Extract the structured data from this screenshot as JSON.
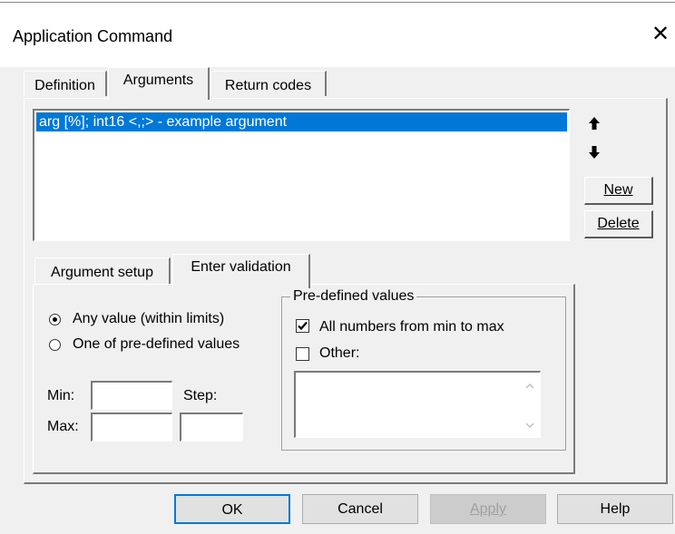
{
  "window": {
    "title": "Application Command",
    "close_glyph": "✕"
  },
  "tabs": [
    {
      "label": "Definition"
    },
    {
      "label": "Arguments"
    },
    {
      "label": "Return codes"
    }
  ],
  "arguments_list": {
    "items": [
      "arg [%]; int16 <,;> - example argument"
    ],
    "selected_index": 0
  },
  "side_buttons": {
    "up_icon": "▲",
    "down_icon": "▼",
    "new_label": "New",
    "delete_label": "Delete"
  },
  "subtabs": [
    {
      "label": "Argument setup"
    },
    {
      "label": "Enter validation"
    }
  ],
  "validation": {
    "any_value_label": "Any value (within limits)",
    "any_value_selected": true,
    "one_of_label": "One of pre-defined values",
    "one_of_selected": false,
    "min_label": "Min:",
    "max_label": "Max:",
    "step_label": "Step:",
    "min_value": "",
    "max_value": "",
    "step_value": "",
    "step2_value": ""
  },
  "predefined": {
    "group_label": "Pre-defined values",
    "all_numbers_label": "All numbers from min to max",
    "all_numbers_checked": true,
    "other_label": "Other:",
    "other_checked": false,
    "other_text": ""
  },
  "footer": {
    "ok_label": "OK",
    "cancel_label": "Cancel",
    "apply_label": "Apply",
    "help_label": "Help"
  },
  "colors": {
    "selection": "#0078d7",
    "face": "#f0f0f0"
  }
}
